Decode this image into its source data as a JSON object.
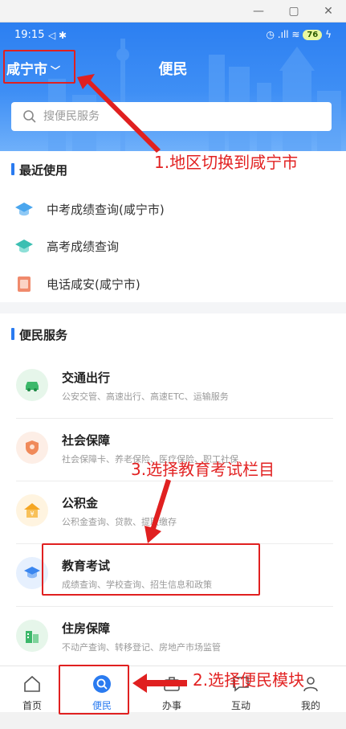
{
  "window": {
    "minimize": "—",
    "maximize": "▢",
    "close": "✕"
  },
  "status_bar": {
    "time": "19:15",
    "telemetry": "◁ ✱",
    "right": "◷ .ıll ≋",
    "battery": "76",
    "charge": "ϟ"
  },
  "header": {
    "city": "咸宁市",
    "title": "便民"
  },
  "search": {
    "placeholder": "搜便民服务"
  },
  "recent": {
    "title": "最近使用",
    "items": [
      {
        "label": "中考成绩查询(咸宁市)",
        "icon": "graduation-cap-icon"
      },
      {
        "label": "高考成绩查询",
        "icon": "graduation-cap-icon"
      },
      {
        "label": "电话咸安(咸宁市)",
        "icon": "phone-book-icon"
      }
    ]
  },
  "services": {
    "title": "便民服务",
    "items": [
      {
        "name": "交通出行",
        "desc": "公安交管、高速出行、高速ETC、运输服务",
        "icon": "car-icon",
        "color": "#e6f6ea"
      },
      {
        "name": "社会保障",
        "desc": "社会保障卡、养老保险、医疗保险、职工社保",
        "icon": "shield-icon",
        "color": "#fdeee6"
      },
      {
        "name": "公积金",
        "desc": "公积金查询、贷款、提取缴存",
        "icon": "house-icon",
        "color": "#fff4e0"
      },
      {
        "name": "教育考试",
        "desc": "成绩查询、学校查询、招生信息和政策",
        "icon": "graduation-cap-icon",
        "color": "#e6f0fe"
      },
      {
        "name": "住房保障",
        "desc": "不动产查询、转移登记、房地产市场监管",
        "icon": "building-icon",
        "color": "#e6f6ea"
      }
    ]
  },
  "annotations": {
    "step1": "1.地区切换到咸宁市",
    "step2": "2.选择便民模块",
    "step3": "3.选择教育考试栏目"
  },
  "nav": {
    "items": [
      {
        "label": "首页",
        "icon": "home-icon"
      },
      {
        "label": "便民",
        "icon": "search-circle-icon",
        "active": true
      },
      {
        "label": "办事",
        "icon": "briefcase-icon"
      },
      {
        "label": "互动",
        "icon": "chat-icon"
      },
      {
        "label": "我的",
        "icon": "user-icon"
      }
    ]
  },
  "colors": {
    "primary": "#2a7bf0",
    "annotation": "#e22222"
  }
}
